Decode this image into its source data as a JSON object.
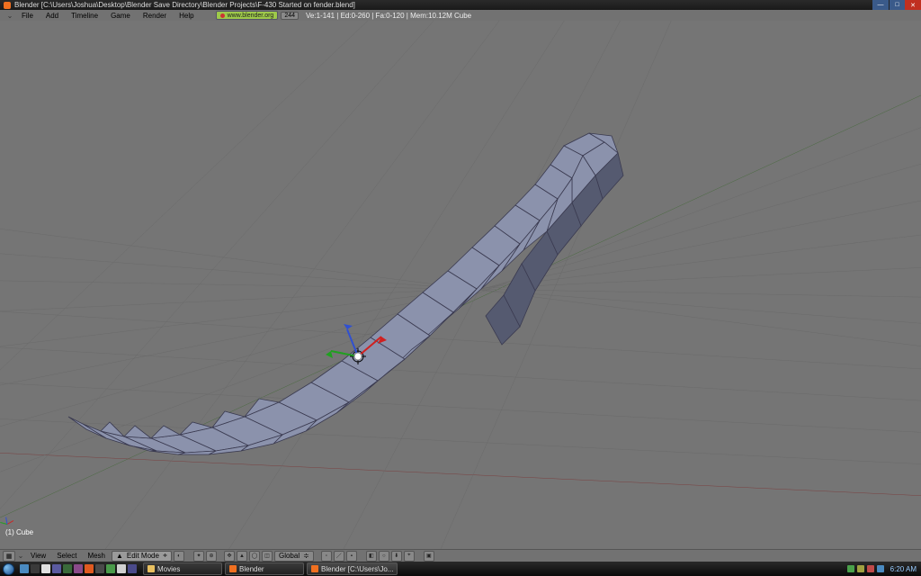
{
  "titlebar": {
    "app_title": "Blender [C:\\Users\\Joshua\\Desktop\\Blender Save Directory\\Blender Projects\\F-430 Started on fender.blend]"
  },
  "menu": {
    "items": [
      "File",
      "Add",
      "Timeline",
      "Game",
      "Render",
      "Help"
    ]
  },
  "header": {
    "url": "www.blender.org",
    "version": "244",
    "stats": "Ve:1-141 | Ed:0-260 | Fa:0-120 | Mem:10.12M  Cube"
  },
  "viewport": {
    "object_label": "(1) Cube"
  },
  "vheader": {
    "view": "View",
    "select": "Select",
    "mesh": "Mesh",
    "mode": "Edit Mode",
    "orientation": "Global"
  },
  "taskbar": {
    "tasks": [
      {
        "label": "Movies",
        "icon": "folder"
      },
      {
        "label": "Blender",
        "icon": "blender"
      },
      {
        "label": "Blender [C:\\Users\\Jo...",
        "icon": "blender"
      }
    ],
    "clock": "6:20 AM"
  }
}
